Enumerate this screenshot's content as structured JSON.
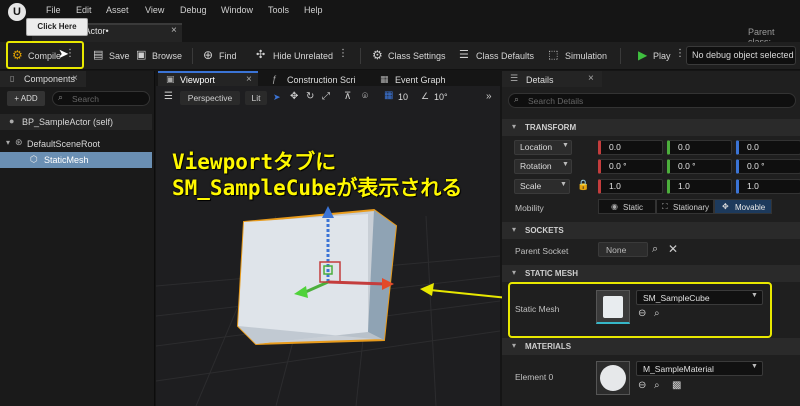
{
  "menu": {
    "items": [
      "File",
      "Edit",
      "Asset",
      "View",
      "Debug",
      "Window",
      "Tools",
      "Help"
    ]
  },
  "document_tab": {
    "label": "ampleActor•",
    "close": "×"
  },
  "parent_class_label": "Parent class:",
  "tooltip": "Click Here",
  "toolbar": {
    "compile": "Compile",
    "save": "Save",
    "browse": "Browse",
    "find": "Find",
    "hide_unrelated": "Hide Unrelated",
    "class_settings": "Class Settings",
    "class_defaults": "Class Defaults",
    "simulation": "Simulation",
    "play": "Play",
    "debug_object": "No debug object selected"
  },
  "components": {
    "tab": "Components",
    "add": "+ ADD",
    "search_placeholder": "Search",
    "self_row": "BP_SampleActor (self)",
    "scene_root": "DefaultSceneRoot",
    "static_mesh": "StaticMesh"
  },
  "viewport": {
    "tabs": [
      "Viewport",
      "Construction Scri",
      "Event Graph"
    ],
    "perspective": "Perspective",
    "lit": "Lit",
    "grid_snap": "10",
    "rot_snap": "10°"
  },
  "annotation": {
    "line1": "Viewportタブに",
    "line2": "SM_SampleCubeが表示される"
  },
  "details": {
    "tab": "Details",
    "search_placeholder": "Search Details",
    "transform": {
      "header": "TRANSFORM",
      "location_label": "Location",
      "rotation_label": "Rotation",
      "scale_label": "Scale",
      "location": [
        "0.0",
        "0.0",
        "0.0"
      ],
      "rotation": [
        "0.0 °",
        "0.0 °",
        "0.0 °"
      ],
      "scale": [
        "1.0",
        "1.0",
        "1.0"
      ],
      "mobility_label": "Mobility",
      "mobility_options": [
        "Static",
        "Stationary",
        "Movable"
      ]
    },
    "sockets": {
      "header": "SOCKETS",
      "parent_socket_label": "Parent Socket",
      "parent_socket_value": "None"
    },
    "static_mesh": {
      "header": "STATIC MESH",
      "label": "Static Mesh",
      "value": "SM_SampleCube"
    },
    "materials": {
      "header": "MATERIALS",
      "element_label": "Element 0",
      "value": "M_SampleMaterial"
    }
  },
  "colors": {
    "highlight": "#e8e800",
    "accent_blue": "#1d3a5c",
    "axis_x": "#c43d3d",
    "axis_y": "#4caf3c",
    "axis_z": "#3b74d6"
  }
}
